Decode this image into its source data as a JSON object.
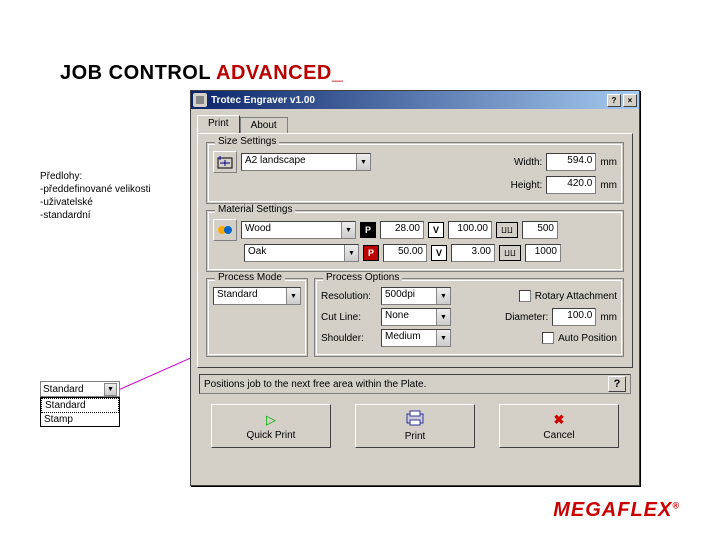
{
  "title": {
    "t1": "JOB CONTROL ",
    "t2": "ADVANCED",
    "cursor": "_"
  },
  "callout": {
    "line1": "Předlohy:",
    "line2": "-předdefinované velikosti",
    "line3": "-uživatelské",
    "line4": "-standardní"
  },
  "popup": {
    "selected": "Standard",
    "items": [
      "Standard",
      "Stamp"
    ]
  },
  "dialog": {
    "window_title": "Trotec Engraver v1.00",
    "help_icon": "?",
    "close_icon": "×",
    "tabs": {
      "print": "Print",
      "about": "About"
    },
    "size": {
      "group": "Size Settings",
      "template": "A2 landscape",
      "width_label": "Width:",
      "width": "594.0",
      "height_label": "Height:",
      "height": "420.0",
      "unit": "mm"
    },
    "material": {
      "group": "Material Settings",
      "cat": "Wood",
      "type": "Oak",
      "row1": {
        "p": "P",
        "pval": "28.00",
        "v": "V",
        "vval": "100.00",
        "hz": "500"
      },
      "row2": {
        "p": "P",
        "pval": "50.00",
        "v": "V",
        "vval": "3.00",
        "hz": "1000"
      }
    },
    "process": {
      "mode_group": "Process Mode",
      "mode": "Standard",
      "options_group": "Process Options",
      "resolution_label": "Resolution:",
      "resolution": "500dpi",
      "cutline_label": "Cut Line:",
      "cutline": "None",
      "shoulder_label": "Shoulder:",
      "shoulder": "Medium",
      "rotary_label": "Rotary Attachment",
      "diameter_label": "Diameter:",
      "diameter": "100.0",
      "diameter_unit": "mm",
      "autopos_label": "Auto Position"
    },
    "status": "Positions job to the next free area within the Plate.",
    "status_help": "?",
    "buttons": {
      "quick": "Quick Print",
      "print": "Print",
      "cancel": "Cancel"
    }
  },
  "logo": {
    "text": "MEGAFLEX",
    "reg": "®"
  }
}
